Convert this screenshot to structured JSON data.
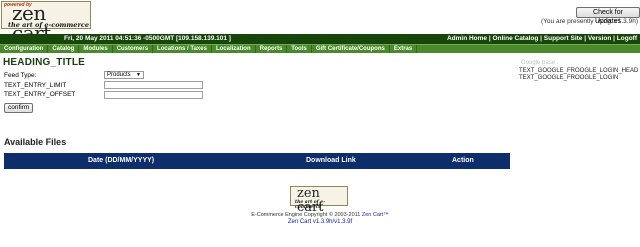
{
  "logo": {
    "powered": "powered by",
    "name": "zen cart",
    "tagline": "the art of e-commerce"
  },
  "top": {
    "update_button": "Check for Updates",
    "version_note": "(You are presently using: v1.3.9h)"
  },
  "header": {
    "datetime": "Fri, 20 May 2011 04:51:36 -0500GMT [109.158.139.101 ]",
    "links": [
      "Admin Home",
      "Online Catalog",
      "Support Site",
      "Version",
      "Logoff"
    ],
    "separator": " | "
  },
  "menu": [
    "Configuration",
    "Catalog",
    "Modules",
    "Customers",
    "Locations / Taxes",
    "Localization",
    "Reports",
    "Tools",
    "Gift Certificate/Coupons",
    "Extras"
  ],
  "page": {
    "title": "HEADING_TITLE"
  },
  "google_box": {
    "faded_text": "Google  base  .",
    "lines": [
      "TEXT_GOOGLE_FROOGLE_LOGIN_HEAD",
      "TEXT_GOOGLE_FROOGLE_LOGIN"
    ]
  },
  "form": {
    "feed_type_label": "Feed Type:",
    "feed_type_value": "Products",
    "limit_label": "TEXT_ENTRY_LIMIT",
    "offset_label": "TEXT_ENTRY_OFFSET",
    "confirm_button": "confirm"
  },
  "files": {
    "title": "Available Files",
    "columns": [
      "Date (DD/MM/YYYY)",
      "Download Link",
      "Action"
    ]
  },
  "footer": {
    "copyright": "E-Commerce Engine Copyright © 2003-2011 ",
    "link": "Zen Cart™",
    "version": "Zen Cart v1.3.9h/v1.3.9f"
  },
  "colors": {
    "header_bg": "#17450a",
    "menu_bg": "#4a8a2c",
    "table_bg": "#0d2d6b"
  }
}
